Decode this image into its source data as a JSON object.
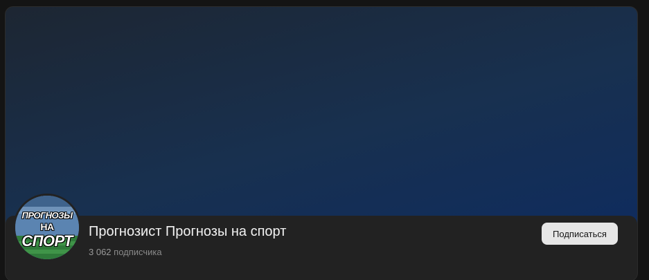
{
  "channel": {
    "title": "Прогнозист Прогнозы на спорт",
    "subscriber_count": "3 062",
    "subscriber_label": "подписчика",
    "avatar": {
      "line1": "ПРОГНОЗЫ",
      "line2": "НА",
      "line3": "СПОРТ",
      "icon": "stadium-logo-icon"
    }
  },
  "actions": {
    "subscribe_label": "Подписаться"
  },
  "colors": {
    "page_background": "#141414",
    "panel_background": "#222222",
    "cover_gradient_start": "#1d2632",
    "cover_gradient_end": "#0f2c5e",
    "button_background": "#e6e6e6"
  }
}
